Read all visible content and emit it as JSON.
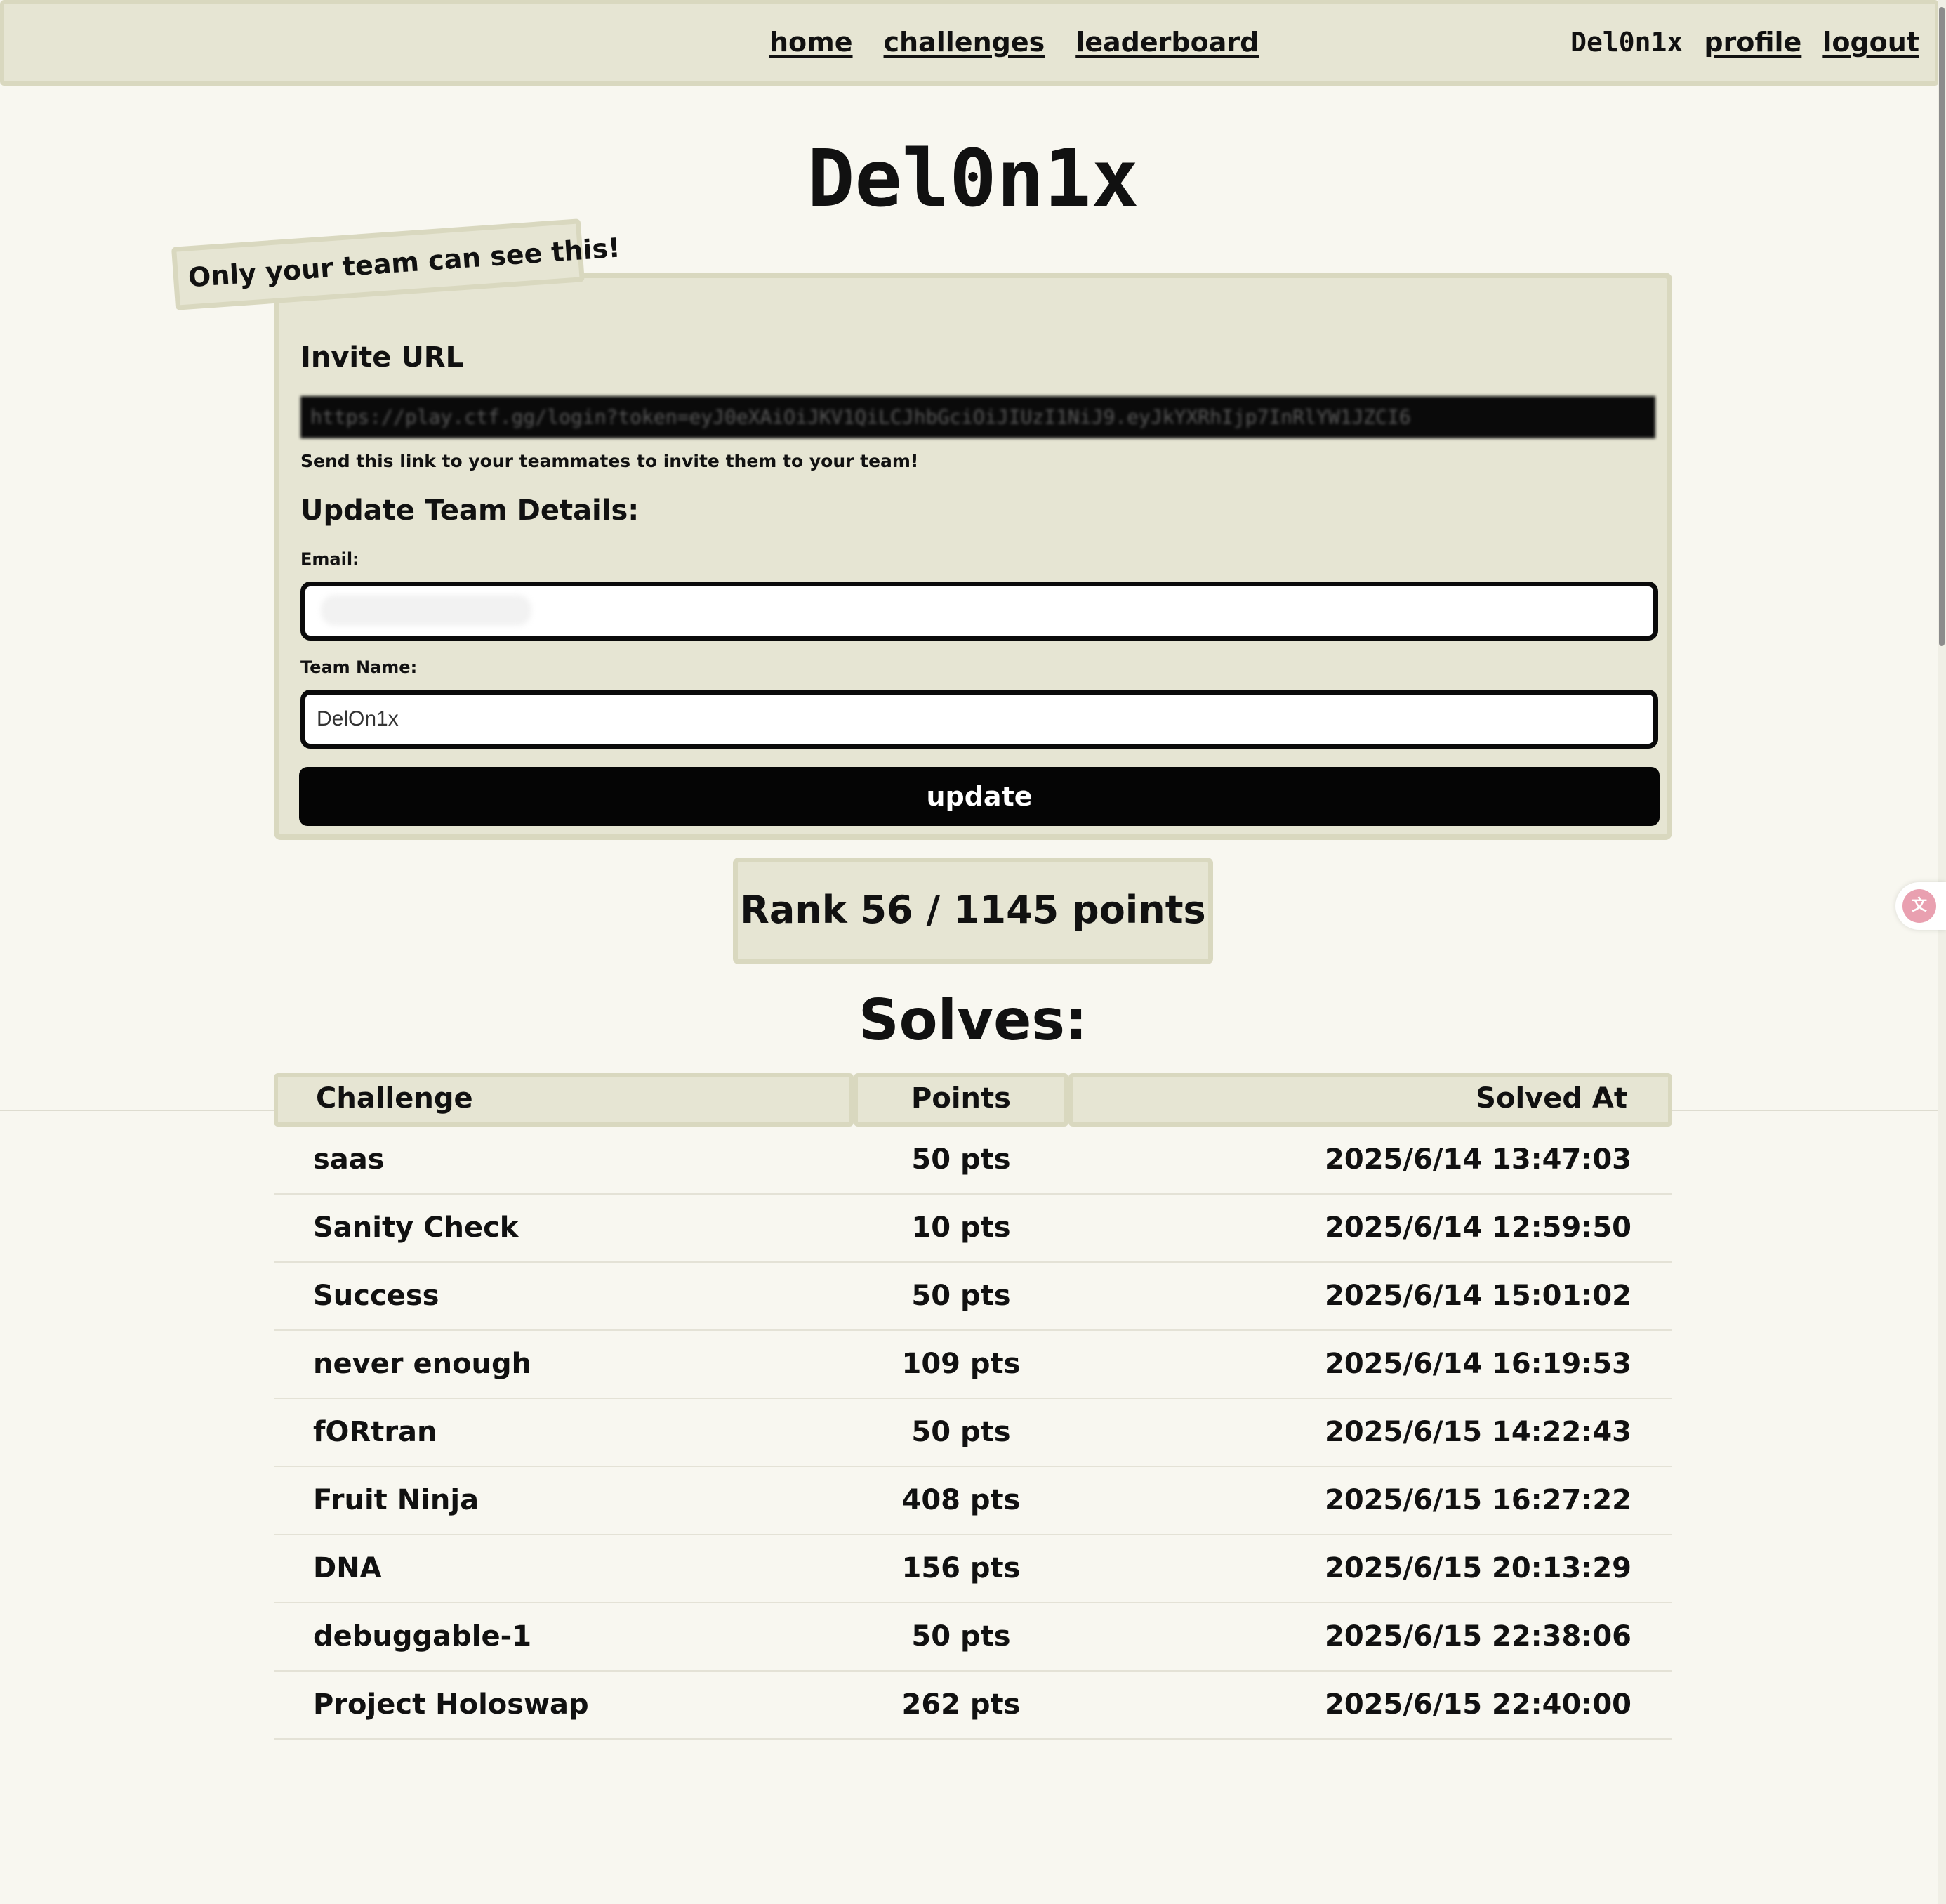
{
  "nav": {
    "links": [
      "home",
      "challenges",
      "leaderboard"
    ],
    "username": "Del0n1x",
    "profile": "profile",
    "logout": "logout"
  },
  "title": "Del0n1x",
  "team_panel": {
    "private_notice": "Only your team can see this!",
    "invite_heading": "Invite URL",
    "invite_url": "https://play.ctf.gg/login?token=eyJ0eXAiOiJKV1QiLCJhbGciOiJIUzI1NiJ9.eyJkYXRhIjp7InRlYW1JZCI6",
    "invite_help": "Send this link to your teammates to invite them to your team!",
    "update_heading": "Update Team Details:",
    "email_label": "Email:",
    "email_value": "",
    "team_name_label": "Team Name:",
    "team_name_value": "DelOn1x",
    "update_button": "update"
  },
  "rank": "Rank 56 / 1145 points",
  "solves_heading": "Solves:",
  "table": {
    "headers": {
      "challenge": "Challenge",
      "points": "Points",
      "solved_at": "Solved At"
    },
    "rows": [
      {
        "challenge": "saas",
        "points": "50 pts",
        "solved_at": "2025/6/14 13:47:03"
      },
      {
        "challenge": "Sanity Check",
        "points": "10 pts",
        "solved_at": "2025/6/14 12:59:50"
      },
      {
        "challenge": "Success",
        "points": "50 pts",
        "solved_at": "2025/6/14 15:01:02"
      },
      {
        "challenge": "never enough",
        "points": "109 pts",
        "solved_at": "2025/6/14 16:19:53"
      },
      {
        "challenge": "fORtran",
        "points": "50 pts",
        "solved_at": "2025/6/15 14:22:43"
      },
      {
        "challenge": "Fruit Ninja",
        "points": "408 pts",
        "solved_at": "2025/6/15 16:27:22"
      },
      {
        "challenge": "DNA",
        "points": "156 pts",
        "solved_at": "2025/6/15 20:13:29"
      },
      {
        "challenge": "debuggable-1",
        "points": "50 pts",
        "solved_at": "2025/6/15 22:38:06"
      },
      {
        "challenge": "Project Holoswap",
        "points": "262 pts",
        "solved_at": "2025/6/15 22:40:00"
      }
    ]
  },
  "colors": {
    "page_bg": "#f8f7f0",
    "panel_bg": "#e6e5d3",
    "panel_border": "#d9d8bf",
    "button_bg": "#050505",
    "translate_badge": "#e9a0b0"
  },
  "icons": {
    "translate_badge": "translate-icon"
  }
}
